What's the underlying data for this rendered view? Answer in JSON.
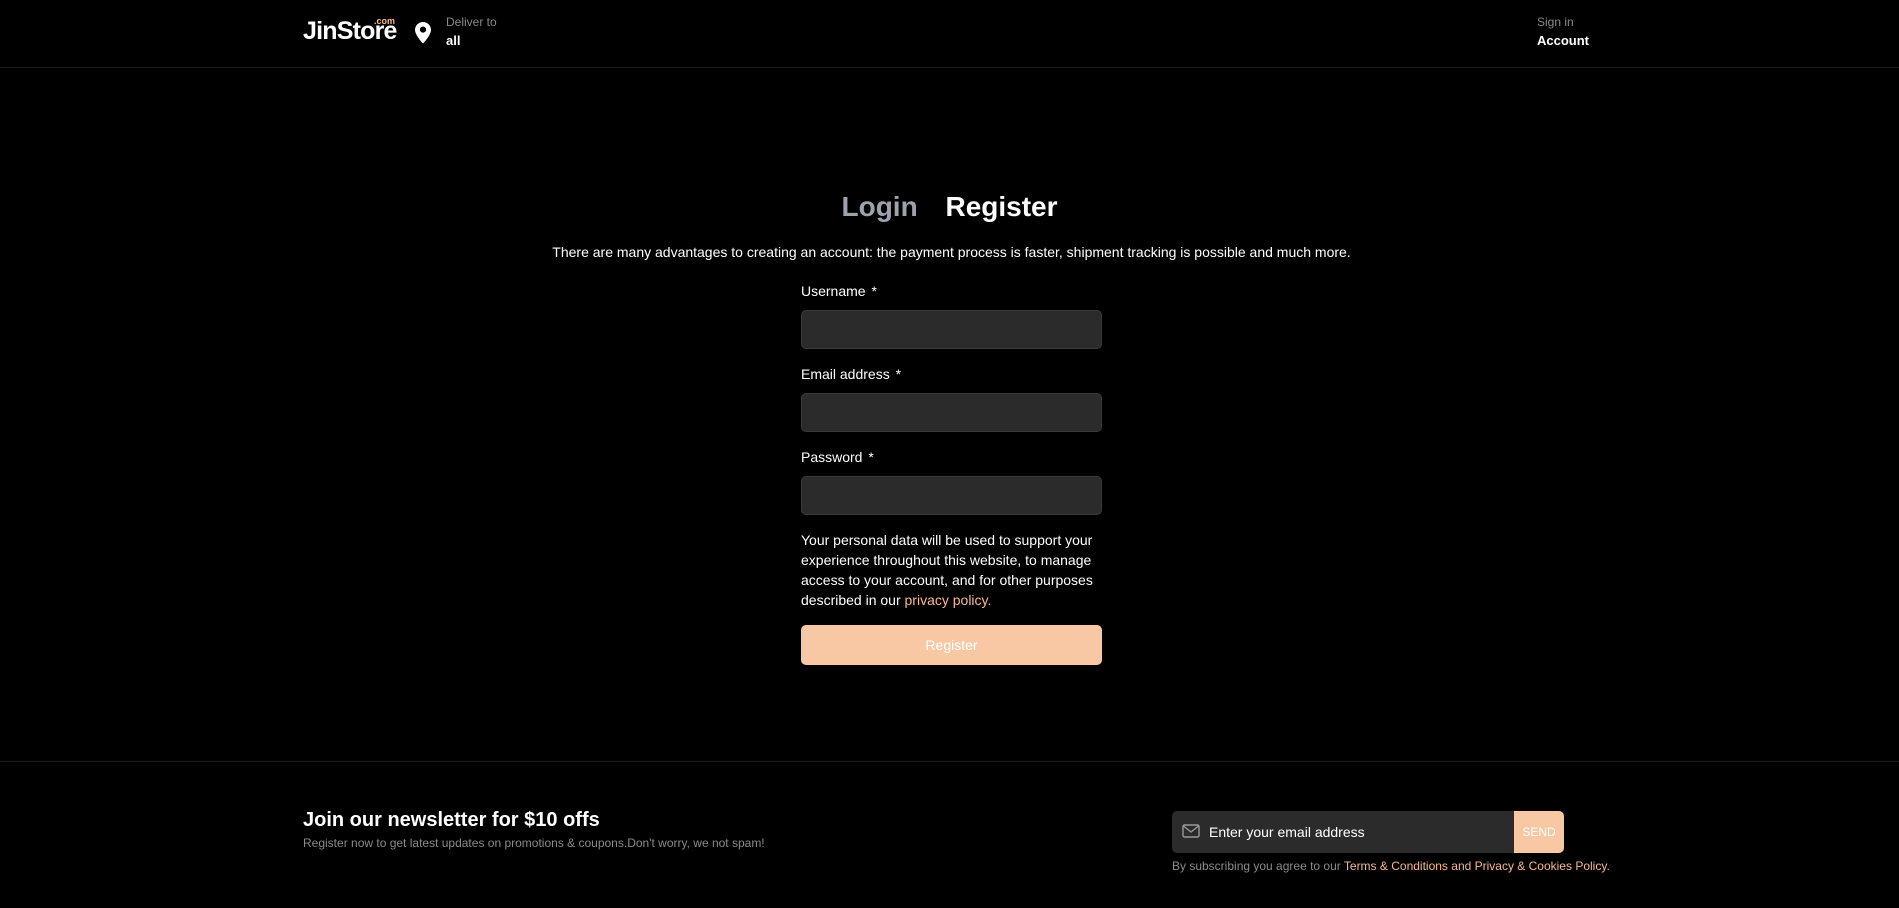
{
  "header": {
    "logo_text": "JinStore",
    "logo_suffix": ".com",
    "deliver_label": "Deliver to",
    "deliver_value": "all",
    "signin_label": "Sign in",
    "signin_value": "Account"
  },
  "tabs": {
    "login": "Login",
    "register": "Register",
    "active": "register"
  },
  "intro": "There are many advantages to creating an account: the payment process is faster, shipment tracking is possible and much more.",
  "form": {
    "username_label": "Username",
    "username_value": "",
    "email_label": "Email address",
    "email_value": "",
    "password_label": "Password",
    "password_value": "",
    "required_marker": "*",
    "privacy_text": "Your personal data will be used to support your experience throughout this website, to manage access to your account, and for other purposes described in our",
    "privacy_link": "privacy policy.",
    "submit_label": "Register"
  },
  "newsletter": {
    "title": "Join our newsletter for $10 offs",
    "subtitle": "Register now to get latest updates on promotions & coupons.Don't worry, we not spam!",
    "placeholder": "Enter your email address",
    "send_label": "SEND",
    "terms_prefix": "By subscribing you agree to our",
    "terms_link": "Terms & Conditions and Privacy & Cookies Policy."
  },
  "colors": {
    "background": "#000000",
    "accent": "#f7b98c",
    "button": "#f8c8a4",
    "input_bg": "#2b2b2b",
    "muted_text": "#8a8a8a",
    "inactive_tab": "#9ca3af"
  },
  "icons": {
    "location": "map-pin-icon",
    "mail": "mail-icon"
  }
}
